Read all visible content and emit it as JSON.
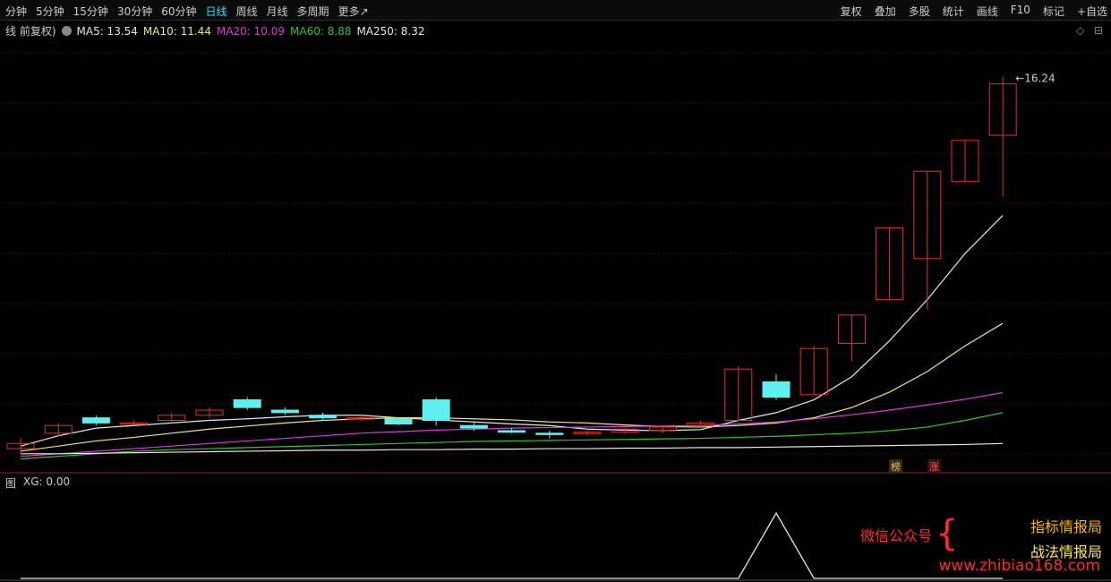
{
  "topbar": {
    "periods": [
      "分钟",
      "5分钟",
      "15分钟",
      "30分钟",
      "60分钟",
      "日线",
      "周线",
      "月线",
      "多周期",
      "更多↗"
    ],
    "active_period": "日线",
    "tools": [
      "复权",
      "叠加",
      "多股",
      "统计",
      "画线",
      "F10",
      "标记",
      "+自选"
    ]
  },
  "legend": {
    "title": "线 前复权)",
    "items": [
      {
        "label": "MA5: 13.54",
        "color": "#e6e6e6"
      },
      {
        "label": "MA10: 11.44",
        "color": "#f2e27a"
      },
      {
        "label": "MA20: 10.09",
        "color": "#d83bd8"
      },
      {
        "label": "MA60: 8.88",
        "color": "#2dc42d"
      },
      {
        "label": "MA250: 8.32",
        "color": "#e6e6e6"
      }
    ]
  },
  "controls": {
    "diamond": "◇",
    "collapse": "⊟"
  },
  "high_label": "16.24",
  "badges": [
    {
      "text": "榜",
      "color": "#e8c07a"
    },
    {
      "text": "涨",
      "color": "#ff5a5a"
    }
  ],
  "sub_legend": {
    "title": "图",
    "xg": "XG: 0.00"
  },
  "watermark": {
    "left": "微信公众号",
    "line1": "指标情报局",
    "line2": "战法情报局",
    "url": "www.zhibiao168.com"
  },
  "colors": {
    "up": "#e8302a",
    "down": "#5ef0f0",
    "grid": "#8a1a1a",
    "cyan_active": "#37d9f1"
  },
  "chart_data": {
    "type": "candlestick",
    "candles": [
      {
        "o": 9.0,
        "h": 9.2,
        "l": 8.9,
        "c": 9.1
      },
      {
        "o": 9.3,
        "h": 9.5,
        "l": 9.25,
        "c": 9.45
      },
      {
        "o": 9.6,
        "h": 9.65,
        "l": 9.45,
        "c": 9.5
      },
      {
        "o": 9.5,
        "h": 9.55,
        "l": 9.45,
        "c": 9.5
      },
      {
        "o": 9.55,
        "h": 9.7,
        "l": 9.5,
        "c": 9.65
      },
      {
        "o": 9.65,
        "h": 9.8,
        "l": 9.6,
        "c": 9.75
      },
      {
        "o": 9.95,
        "h": 10.0,
        "l": 9.75,
        "c": 9.8
      },
      {
        "o": 9.75,
        "h": 9.8,
        "l": 9.65,
        "c": 9.7
      },
      {
        "o": 9.65,
        "h": 9.7,
        "l": 9.55,
        "c": 9.6
      },
      {
        "o": 9.6,
        "h": 9.65,
        "l": 9.55,
        "c": 9.6
      },
      {
        "o": 9.58,
        "h": 9.6,
        "l": 9.45,
        "c": 9.48
      },
      {
        "o": 9.95,
        "h": 10.0,
        "l": 9.45,
        "c": 9.55
      },
      {
        "o": 9.45,
        "h": 9.5,
        "l": 9.35,
        "c": 9.4
      },
      {
        "o": 9.35,
        "h": 9.4,
        "l": 9.3,
        "c": 9.32
      },
      {
        "o": 9.3,
        "h": 9.35,
        "l": 9.2,
        "c": 9.28
      },
      {
        "o": 9.3,
        "h": 9.35,
        "l": 9.25,
        "c": 9.32
      },
      {
        "o": 9.32,
        "h": 9.4,
        "l": 9.3,
        "c": 9.38
      },
      {
        "o": 9.35,
        "h": 9.45,
        "l": 9.3,
        "c": 9.42
      },
      {
        "o": 9.45,
        "h": 9.55,
        "l": 9.4,
        "c": 9.5
      },
      {
        "o": 9.55,
        "h": 10.6,
        "l": 9.55,
        "c": 10.55
      },
      {
        "o": 10.3,
        "h": 10.45,
        "l": 9.95,
        "c": 10.0
      },
      {
        "o": 10.05,
        "h": 11.0,
        "l": 10.05,
        "c": 10.95
      },
      {
        "o": 11.05,
        "h": 11.6,
        "l": 10.7,
        "c": 11.6
      },
      {
        "o": 11.9,
        "h": 13.3,
        "l": 11.9,
        "c": 13.3
      },
      {
        "o": 12.7,
        "h": 14.4,
        "l": 11.7,
        "c": 14.4
      },
      {
        "o": 14.2,
        "h": 15.0,
        "l": 14.2,
        "c": 15.0
      },
      {
        "o": 15.1,
        "h": 16.24,
        "l": 13.9,
        "c": 16.1
      }
    ],
    "ma": [
      {
        "name": "MA5",
        "color": "#e6e6e6",
        "values": [
          9.05,
          9.25,
          9.4,
          9.45,
          9.5,
          9.55,
          9.58,
          9.62,
          9.65,
          9.65,
          9.6,
          9.56,
          9.52,
          9.48,
          9.45,
          9.38,
          9.36,
          9.35,
          9.37,
          9.55,
          9.7,
          9.95,
          10.4,
          11.1,
          11.9,
          12.8,
          13.54
        ]
      },
      {
        "name": "MA10",
        "color": "#f2e27a",
        "values": [
          8.95,
          9.05,
          9.15,
          9.22,
          9.3,
          9.38,
          9.44,
          9.5,
          9.55,
          9.58,
          9.6,
          9.6,
          9.58,
          9.56,
          9.52,
          9.5,
          9.46,
          9.43,
          9.42,
          9.45,
          9.5,
          9.6,
          9.8,
          10.1,
          10.5,
          11.0,
          11.44
        ]
      },
      {
        "name": "MA20",
        "color": "#d83bd8",
        "values": [
          8.85,
          8.9,
          8.95,
          9.0,
          9.05,
          9.1,
          9.15,
          9.2,
          9.25,
          9.3,
          9.33,
          9.36,
          9.38,
          9.4,
          9.41,
          9.42,
          9.43,
          9.44,
          9.45,
          9.48,
          9.52,
          9.58,
          9.66,
          9.75,
          9.85,
          9.96,
          10.09
        ]
      },
      {
        "name": "MA60",
        "color": "#2dc42d",
        "values": [
          8.8,
          8.85,
          8.9,
          8.95,
          8.98,
          9.0,
          9.02,
          9.04,
          9.06,
          9.08,
          9.1,
          9.12,
          9.14,
          9.15,
          9.16,
          9.17,
          9.18,
          9.19,
          9.2,
          9.22,
          9.24,
          9.27,
          9.3,
          9.35,
          9.42,
          9.55,
          9.7
        ]
      },
      {
        "name": "MA250",
        "color": "#e6e6e6",
        "values": [
          8.9,
          8.9,
          8.91,
          8.92,
          8.93,
          8.94,
          8.95,
          8.96,
          8.97,
          8.97,
          8.98,
          8.98,
          8.99,
          8.99,
          9.0,
          9.0,
          9.01,
          9.01,
          9.02,
          9.02,
          9.03,
          9.04,
          9.05,
          9.06,
          9.07,
          9.08,
          9.1
        ]
      }
    ],
    "xg": [
      0,
      0,
      0,
      0,
      0,
      0,
      0,
      0,
      0,
      0,
      0,
      0,
      0,
      0,
      0,
      0,
      0,
      0,
      0,
      0,
      1,
      0,
      0,
      0,
      0,
      0,
      0
    ],
    "ylim": [
      8.6,
      16.6
    ]
  }
}
